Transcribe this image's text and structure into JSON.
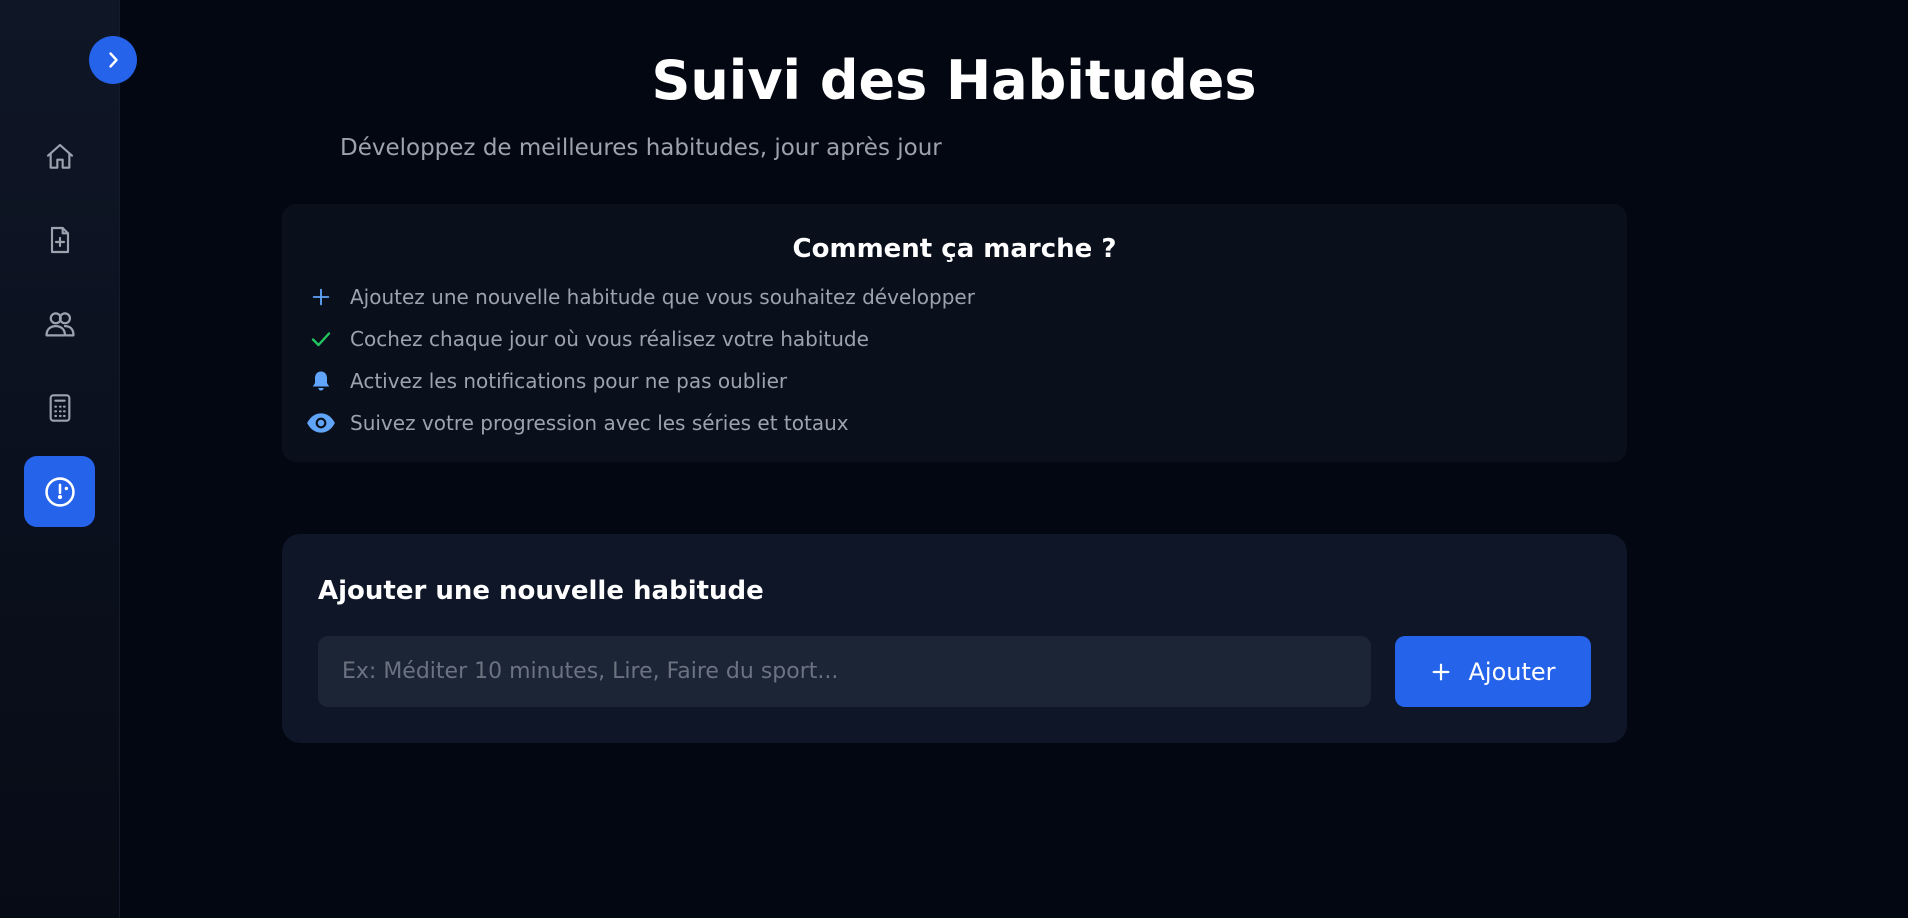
{
  "sidebar": {
    "toggle_icon": "chevron-right-icon",
    "items": [
      {
        "name": "home",
        "icon": "home-icon",
        "active": false
      },
      {
        "name": "new-document",
        "icon": "file-plus-icon",
        "active": false
      },
      {
        "name": "users",
        "icon": "users-icon",
        "active": false
      },
      {
        "name": "calculator",
        "icon": "calculator-icon",
        "active": false
      },
      {
        "name": "habits",
        "icon": "dashboard-gauge-icon",
        "active": true
      }
    ]
  },
  "header": {
    "title": "Suivi des Habitudes",
    "subtitle": "Développez de meilleures habitudes, jour après jour"
  },
  "how_it_works": {
    "title": "Comment ça marche ?",
    "steps": [
      {
        "icon": "plus-icon",
        "text": "Ajoutez une nouvelle habitude que vous souhaitez développer"
      },
      {
        "icon": "check-icon",
        "text": "Cochez chaque jour où vous réalisez votre habitude"
      },
      {
        "icon": "bell-icon",
        "text": "Activez les notifications pour ne pas oublier"
      },
      {
        "icon": "eye-icon",
        "text": "Suivez votre progression avec les séries et totaux"
      }
    ]
  },
  "add_habit": {
    "title": "Ajouter une nouvelle habitude",
    "input_value": "",
    "input_placeholder": "Ex: Méditer 10 minutes, Lire, Faire du sport...",
    "button_label": "Ajouter"
  },
  "colors": {
    "accent": "#2563eb",
    "background": "#030712",
    "check": "#22c55e",
    "icon_blue": "#60a5fa"
  }
}
